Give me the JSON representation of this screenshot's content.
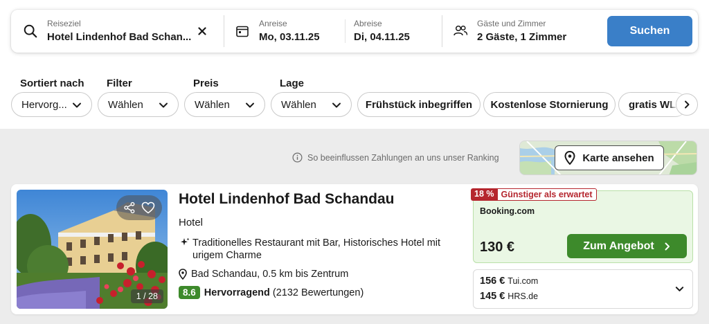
{
  "search": {
    "destination_label": "Reiseziel",
    "destination_value": "Hotel Lindenhof Bad Schan...",
    "checkin_label": "Anreise",
    "checkin_value": "Mo, 03.11.25",
    "checkout_label": "Abreise",
    "checkout_value": "Di, 04.11.25",
    "guests_label": "Gäste und Zimmer",
    "guests_value": "2 Gäste, 1 Zimmer",
    "search_button": "Suchen",
    "search_button_color": "#3a7fc8"
  },
  "filters": {
    "sort_label": "Sortiert nach",
    "sort_value": "Hervorg...",
    "filter_label": "Filter",
    "filter_value": "Wählen",
    "price_label": "Preis",
    "price_value": "Wählen",
    "location_label": "Lage",
    "location_value": "Wählen",
    "chips": [
      "Frühstück inbegriffen",
      "Kostenlose Stornierung",
      "gratis WL"
    ]
  },
  "ranking_note": "So beeinflussen Zahlungen an uns unser Ranking",
  "map_button": "Karte ansehen",
  "hotel": {
    "name": "Hotel Lindenhof Bad Schandau",
    "type": "Hotel",
    "feature": "Traditionelles Restaurant mit Bar, Historisches Hotel mit urigem Charme",
    "location": "Bad Schandau, 0.5 km bis Zentrum",
    "rating_score": "8.6",
    "rating_word": "Hervorragend",
    "rating_count": "(2132 Bewertungen)",
    "photo_counter": "1 / 28",
    "rating_color": "#3d8a2b"
  },
  "deal": {
    "discount_pct": "18 %",
    "discount_text": "Günstiger als erwartet",
    "provider": "Booking.com",
    "price": "130 €",
    "button": "Zum Angebot",
    "button_color": "#3d8a2b",
    "discount_color": "#b5262e"
  },
  "other_offers": [
    {
      "price": "156 €",
      "site": "Tui.com"
    },
    {
      "price": "145 €",
      "site": "HRS.de"
    }
  ]
}
